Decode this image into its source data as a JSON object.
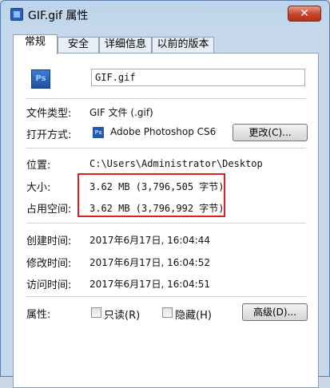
{
  "window": {
    "title": "GIF.gif 属性",
    "close_label": "✕"
  },
  "tabs": [
    {
      "label": "常规",
      "active": true
    },
    {
      "label": "安全"
    },
    {
      "label": "详细信息"
    },
    {
      "label": "以前的版本"
    }
  ],
  "general": {
    "file_icon_text": "Ps",
    "filename": "GIF.gif",
    "file_type_label": "文件类型:",
    "file_type_value": "GIF 文件 (.gif)",
    "open_with_label": "打开方式:",
    "open_with_value": "Adobe Photoshop CS6",
    "change_button": "更改(C)...",
    "location_label": "位置:",
    "location_value": "C:\\Users\\Administrator\\Desktop",
    "size_label": "大小:",
    "size_value": "3.62 MB (3,796,505 字节)",
    "size_on_disk_label": "占用空间:",
    "size_on_disk_value": "3.62 MB (3,796,992 字节)",
    "created_label": "创建时间:",
    "created_value": "2017年6月17日, 16:04:44",
    "modified_label": "修改时间:",
    "modified_value": "2017年6月17日, 16:04:52",
    "accessed_label": "访问时间:",
    "accessed_value": "2017年6月17日, 16:04:51",
    "attributes_label": "属性:",
    "readonly_label": "只读(R)",
    "readonly_checked": false,
    "hidden_label": "隐藏(H)",
    "hidden_checked": false,
    "advanced_button": "高级(D)..."
  },
  "colors": {
    "highlight_box": "#e02020",
    "title_bar": "#c6d9ec"
  }
}
